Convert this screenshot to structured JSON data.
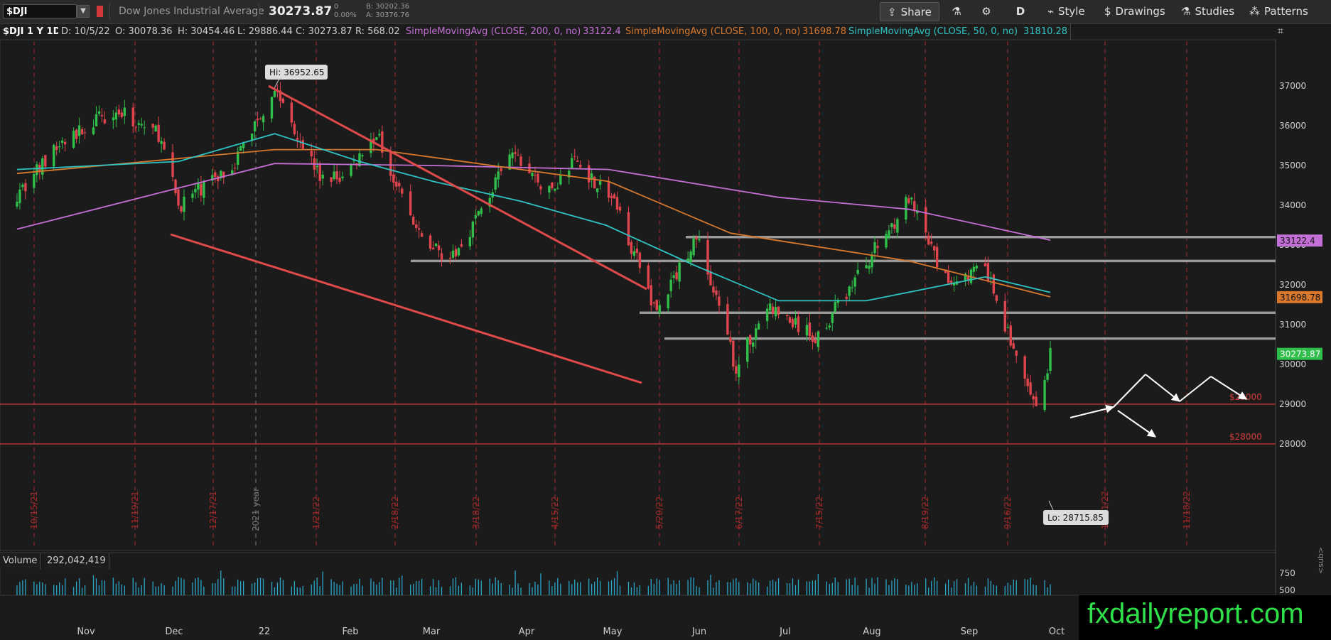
{
  "toolbar": {
    "symbol": "$DJI",
    "name": "Dow Jones Industrial Average",
    "last": "30273.87",
    "change": "0",
    "change_pct": "0.00%",
    "bid": "B: 30202.36",
    "ask": "A: 30376.76",
    "share_label": "Share",
    "timeframe_label": "D",
    "style_label": "Style",
    "drawings_label": "Drawings",
    "studies_label": "Studies",
    "patterns_label": "Patterns"
  },
  "infobar": {
    "title": "$DJI 1 Y 1D",
    "date": "D: 10/5/22",
    "open": "O: 30078.36",
    "high": "H: 30454.46",
    "low": "L: 29886.44",
    "close": "C: 30273.87",
    "range": "R: 568.02",
    "sma200_label": "SimpleMovingAvg (CLOSE, 200, 0, no)",
    "sma200_value": "33122.4",
    "sma100_label": "SimpleMovingAvg (CLOSE, 100, 0, no)",
    "sma100_value": "31698.78",
    "sma50_label": "SimpleMovingAvg (CLOSE, 50, 0, no)",
    "sma50_value": "31810.28"
  },
  "volume": {
    "label": "Volume",
    "value": "292,042,419",
    "ticks": [
      "750",
      "500"
    ]
  },
  "watermark": "fxdailyreport.com",
  "side_label": "<sub>",
  "colors": {
    "up": "#2fbf4a",
    "down": "#e0444d",
    "sma200": "#c46fd6",
    "sma100": "#d7782c",
    "sma50": "#2ec3c3",
    "trendline": "#e04a4a",
    "level": "#9a9a9a",
    "arrow": "#ffffff"
  },
  "chart_data": {
    "type": "candlestick",
    "ylim": [
      27700,
      37700
    ],
    "yticks": [
      28000,
      29000,
      30000,
      31000,
      32000,
      33000,
      34000,
      35000,
      36000,
      37000
    ],
    "x_month_labels": [
      "Nov",
      "Dec",
      "22",
      "Feb",
      "Mar",
      "Apr",
      "May",
      "Jun",
      "Jul",
      "Aug",
      "Sep",
      "Oct"
    ],
    "expiry_labels": [
      "10/15/21",
      "11/19/21",
      "12/17/21",
      "2021 year",
      "1/21/22",
      "2/18/22",
      "3/18/22",
      "4/15/22",
      "5/20/22",
      "6/17/22",
      "7/15/22",
      "8/19/22",
      "9/16/22",
      "10/21/22",
      "11/18/22"
    ],
    "hi_label": "Hi: 36952.65",
    "lo_label": "Lo: 28715.85",
    "price_tags": [
      {
        "value": 33122.4,
        "label": "33122.4",
        "series": "sma200"
      },
      {
        "value": 31698.78,
        "label": "31698.78",
        "series": "sma100"
      },
      {
        "value": 30273.87,
        "label": "30273.87",
        "series": "last"
      },
      {
        "value": 29000,
        "label": "$29000",
        "series": "alert"
      },
      {
        "value": 28000,
        "label": "$28000",
        "series": "alert"
      }
    ],
    "horizontal_levels": [
      33200,
      32600,
      31300,
      30650
    ],
    "close_path": [
      [
        "10/5/21",
        34300
      ],
      [
        "10/20/21",
        35500
      ],
      [
        "11/8/21",
        36400
      ],
      [
        "11/24/21",
        35800
      ],
      [
        "12/1/21",
        34000
      ],
      [
        "12/20/21",
        35000
      ],
      [
        "1/4/22",
        36950
      ],
      [
        "1/20/22",
        34700
      ],
      [
        "1/28/22",
        34700
      ],
      [
        "2/9/22",
        35800
      ],
      [
        "2/24/22",
        33200
      ],
      [
        "3/8/22",
        32650
      ],
      [
        "3/29/22",
        35300
      ],
      [
        "4/11/22",
        34300
      ],
      [
        "4/20/22",
        35150
      ],
      [
        "5/4/22",
        34100
      ],
      [
        "5/19/22",
        31300
      ],
      [
        "6/2/22",
        33250
      ],
      [
        "6/16/22",
        29900
      ],
      [
        "6/27/22",
        31450
      ],
      [
        "7/14/22",
        30650
      ],
      [
        "8/16/22",
        34150
      ],
      [
        "8/29/22",
        32100
      ],
      [
        "9/12/22",
        32400
      ],
      [
        "9/30/22",
        28750
      ],
      [
        "10/5/22",
        30273.87
      ]
    ],
    "sma200_path": [
      [
        "10/5/21",
        33400
      ],
      [
        "1/4/22",
        35050
      ],
      [
        "3/1/22",
        35000
      ],
      [
        "5/2/22",
        34900
      ],
      [
        "7/1/22",
        34200
      ],
      [
        "8/16/22",
        33900
      ],
      [
        "10/5/22",
        33122.4
      ]
    ],
    "sma100_path": [
      [
        "10/5/21",
        34800
      ],
      [
        "1/4/22",
        35400
      ],
      [
        "2/9/22",
        35400
      ],
      [
        "4/1/22",
        34900
      ],
      [
        "5/2/22",
        34600
      ],
      [
        "6/14/22",
        33300
      ],
      [
        "8/16/22",
        32600
      ],
      [
        "10/5/22",
        31698.78
      ]
    ],
    "sma50_path": [
      [
        "10/5/21",
        34900
      ],
      [
        "12/1/21",
        35100
      ],
      [
        "1/4/22",
        35800
      ],
      [
        "2/3/22",
        35100
      ],
      [
        "3/1/22",
        34600
      ],
      [
        "4/1/22",
        34100
      ],
      [
        "5/1/22",
        33500
      ],
      [
        "6/1/22",
        32500
      ],
      [
        "7/1/22",
        31600
      ],
      [
        "8/1/22",
        31600
      ],
      [
        "9/12/22",
        32200
      ],
      [
        "10/5/22",
        31810.28
      ]
    ]
  }
}
